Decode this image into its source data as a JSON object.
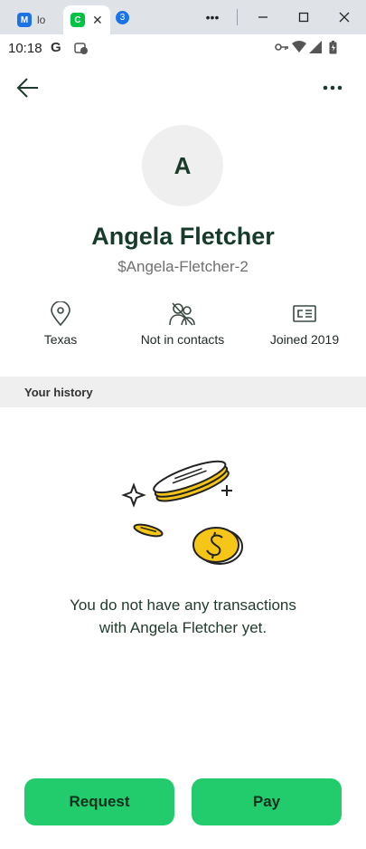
{
  "browser": {
    "tabs": [
      {
        "label": "lo",
        "icon": "m-icon"
      },
      {
        "label": "",
        "icon": "cash-app-icon"
      }
    ],
    "tab_count": "3"
  },
  "status": {
    "time": "10:18",
    "carrier_icon": "G"
  },
  "profile": {
    "initial": "A",
    "name": "Angela Fletcher",
    "cashtag": "$Angela-Fletcher-2"
  },
  "info": [
    {
      "label": "Texas",
      "icon": "location-pin-icon"
    },
    {
      "label": "Not in contacts",
      "icon": "person-off-icon"
    },
    {
      "label": "Joined 2019",
      "icon": "id-card-icon"
    }
  ],
  "history": {
    "title": "Your history",
    "empty_message_line1": "You do not have any transactions",
    "empty_message_line2": "with Angela Fletcher yet."
  },
  "actions": {
    "request_label": "Request",
    "pay_label": "Pay"
  },
  "colors": {
    "accent_green": "#22cc6d",
    "text_dark_green": "#173b2a",
    "coin_yellow": "#f5c518"
  }
}
